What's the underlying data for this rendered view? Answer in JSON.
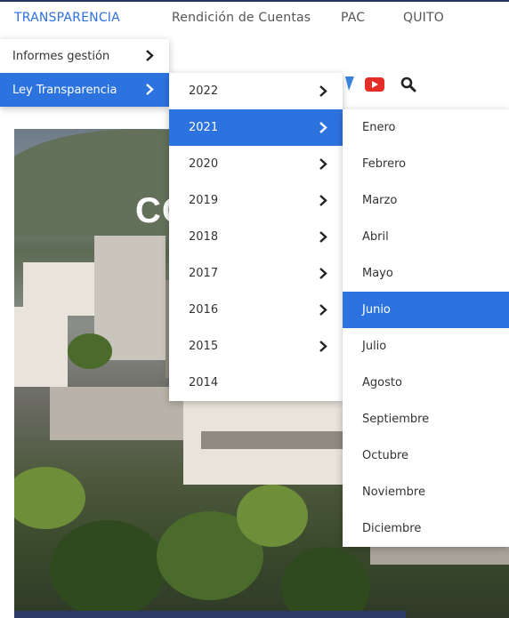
{
  "top_nav": {
    "items": [
      "TRANSPARENCIA",
      "Rendición de Cuentas",
      "PAC",
      "QUITO"
    ]
  },
  "hero": {
    "headline": "CO"
  },
  "menu_level1": {
    "items": [
      "Informes gestión",
      "Ley Transparencia"
    ],
    "selected": "Ley Transparencia"
  },
  "menu_years": {
    "items": [
      "2022",
      "2021",
      "2020",
      "2019",
      "2018",
      "2017",
      "2016",
      "2015",
      "2014"
    ],
    "selected": "2021"
  },
  "menu_months": {
    "items": [
      "Enero",
      "Febrero",
      "Marzo",
      "Abril",
      "Mayo",
      "Junio",
      "Julio",
      "Agosto",
      "Septiembre",
      "Octubre",
      "Noviembre",
      "Diciembre"
    ],
    "selected": "Junio"
  },
  "colors": {
    "accent": "#2d73e0",
    "nav_active": "#2d6fe0",
    "youtube": "#e52d27",
    "bar": "#2e3b69"
  }
}
